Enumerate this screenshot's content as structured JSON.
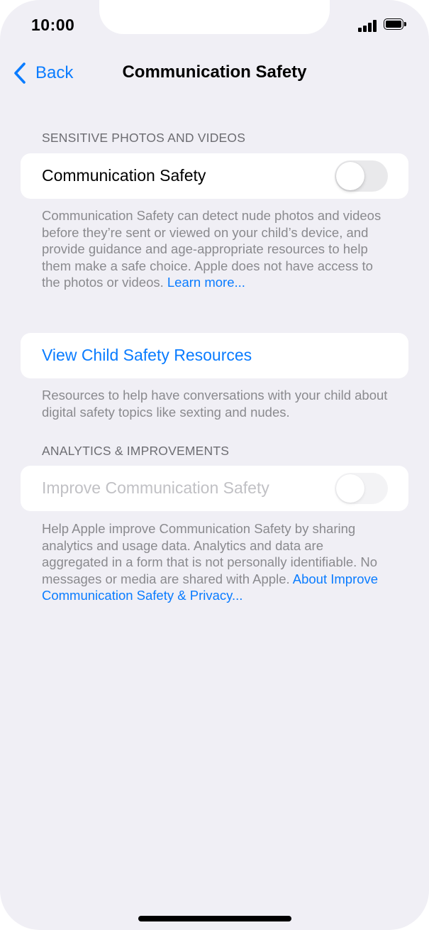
{
  "status_bar": {
    "time": "10:00",
    "signal_icon": "cellular-signal-icon",
    "battery_icon": "battery-icon"
  },
  "nav": {
    "back_label": "Back",
    "title": "Communication Safety"
  },
  "sections": {
    "sensitive": {
      "header": "SENSITIVE PHOTOS AND VIDEOS",
      "row_label": "Communication Safety",
      "toggle_on": false,
      "footer_text": "Communication Safety can detect nude photos and videos before they’re sent or viewed on your child’s device, and provide guidance and age-appropriate resources to help them make a safe choice. Apple does not have access to the photos or videos.",
      "footer_link": "Learn more..."
    },
    "resources": {
      "row_label": "View Child Safety Resources",
      "footer_text": "Resources to help have conversations with your child about digital safety topics like sexting and nudes."
    },
    "analytics": {
      "header": "ANALYTICS & IMPROVEMENTS",
      "row_label": "Improve Communication Safety",
      "toggle_on": false,
      "toggle_disabled": true,
      "footer_text": "Help Apple improve Communication Safety by sharing analytics and usage data. Analytics and data are aggregated in a form that is not personally identifiable. No messages or media are shared with Apple.",
      "footer_link": "About Improve Communication Safety & Privacy..."
    }
  },
  "colors": {
    "background": "#f0eff5",
    "accent": "#0a7cff",
    "card": "#ffffff",
    "secondary_text": "#8a8a8e"
  }
}
